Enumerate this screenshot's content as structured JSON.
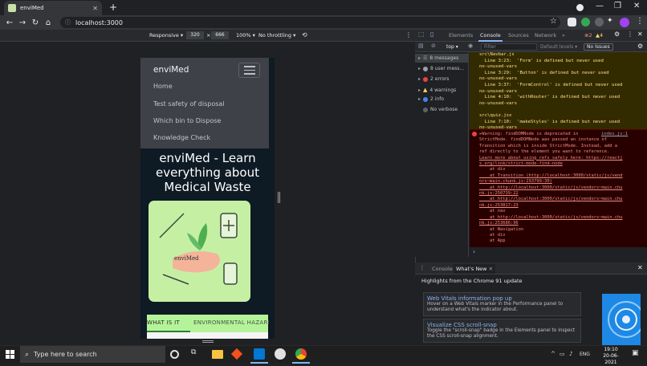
{
  "browser": {
    "tab_title": "enviMed",
    "url": "localhost:3000"
  },
  "device_toolbar": {
    "preset": "Responsive ▾",
    "width": "320",
    "separator": "×",
    "height": "666",
    "zoom": "100% ▾",
    "throttle": "No throttling ▾"
  },
  "page": {
    "brand": "enviMed",
    "nav": [
      "Home",
      "Test safety of disposal",
      "Which bin to Dispose",
      "Knowledge Check"
    ],
    "headline": "enviMed - Learn everything about Medical Waste",
    "illustration_logo": "enviMed",
    "tabs": [
      "WHAT IS IT",
      "ENVIRONMENTAL HAZARD"
    ]
  },
  "devtools": {
    "tabs": [
      "Elements",
      "Console",
      "Sources",
      "Network",
      "»"
    ],
    "active_tab": "Console",
    "error_badge": "2",
    "warn_badge": "4",
    "context": "top ▾",
    "filter_placeholder": "Filter",
    "levels": "Default levels ▾",
    "issues": "No Issues",
    "sidebar": [
      {
        "label": "8 messages",
        "kind": "list"
      },
      {
        "label": "8 user mess...",
        "kind": "user"
      },
      {
        "label": "2 errors",
        "kind": "error"
      },
      {
        "label": "4 warnings",
        "kind": "warning"
      },
      {
        "label": "2 info",
        "kind": "info"
      },
      {
        "label": "No verbose",
        "kind": "verbose"
      }
    ],
    "warning_lines": [
      "src\\Navbar.js",
      "  Line 3:23:  'Form' is defined but never used",
      "no-unused-vars",
      "  Line 3:29:  'Button' is defined but never used",
      "no-unused-vars",
      "  Line 3:37:  'FormControl' is defined but never used",
      "no-unused-vars",
      "  Line 4:10:  'withRouter' is defined but never used",
      "no-unused-vars",
      "",
      "src\\quiz.jsx",
      "  Line 7:10:  'makeStyles' is defined but never used",
      "no-unused-vars"
    ],
    "error_source": "index.js:1",
    "error_lines": [
      "▸Warning: findDOMNode is deprecated in",
      "StrictMode. findDOMNode was passed an instance of",
      "Transition which is inside StrictMode. Instead, add a",
      "ref directly to the element you want to reference.",
      "Learn more about using refs safely here: https://reactj",
      "s.org/link/strict-mode-find-node",
      "    at div",
      "    at Transition (http://localhost:3000/static/js/vend",
      "ors~main.chunk.js:293799:30)",
      "    at http://localhost:3000/static/js/vendors~main.chu",
      "nk.js:250739:22",
      "    at http://localhost:3000/static/js/vendors~main.chu",
      "nk.js:253817:23",
      "    at nav",
      "    at http://localhost:3000/static/js/vendors~main.chu",
      "nk.js:253686:96",
      "    at Navigation",
      "    at div",
      "    at App"
    ],
    "prompt": "›",
    "drawer_tabs": [
      "Console",
      "What's New"
    ],
    "whats_new_title": "Highlights from the Chrome 91 update",
    "cards": [
      {
        "title": "Web Vitals information pop up",
        "body": "Hover on a Web Vitals marker in the Performance panel to understand what's the indicator about."
      },
      {
        "title": "Visualize CSS scroll-snap",
        "body": "Toggle the \"scroll-snap\" badge in the Elements panel to inspect the CSS scroll-snap alignment."
      }
    ]
  },
  "taskbar": {
    "search_placeholder": "Type here to search",
    "time": "19:10",
    "date": "20-06-2021",
    "lang": "ENG"
  },
  "colors": {
    "accent_green": "#c5f0a4",
    "tab_green": "#b5f39a",
    "page_dark": "#0e1a24",
    "error_red": "#f28b82",
    "warn_yellow": "#ffe08a"
  }
}
